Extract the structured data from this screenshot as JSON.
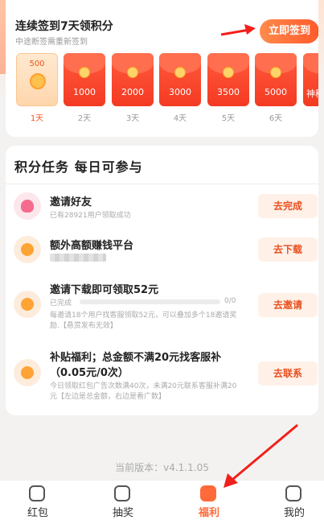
{
  "signin": {
    "title": "连续签到7天领积分",
    "subtitle": "中途断签需重新签到",
    "button": "立即签到",
    "envelopes": [
      {
        "amount": "500",
        "day": "1天",
        "state": "done"
      },
      {
        "amount": "1000",
        "day": "2天",
        "state": "pending"
      },
      {
        "amount": "2000",
        "day": "3天",
        "state": "pending"
      },
      {
        "amount": "3000",
        "day": "4天",
        "state": "pending"
      },
      {
        "amount": "3500",
        "day": "5天",
        "state": "pending"
      },
      {
        "amount": "5000",
        "day": "6天",
        "state": "pending"
      },
      {
        "amount": "神秘",
        "day": "",
        "state": "pending"
      }
    ]
  },
  "tasks": {
    "title": "积分任务  每日可参与",
    "items": [
      {
        "name": "邀请好友",
        "desc": "已有28921用户领取成功",
        "button": "去完成",
        "icon": "user-icon"
      },
      {
        "name": "额外高额赚钱平台",
        "desc": "",
        "button": "去下载",
        "icon": "coin-icon"
      },
      {
        "name": "邀请下载即可领取52元",
        "status": "已完成",
        "progress": "0/0",
        "progress_fraction": 0,
        "desc1": "每邀请18个用户找客服领取52元，可以叠加多个18邀请奖",
        "desc2": "励.【悬赏发布无效】",
        "button": "去邀请",
        "icon": "coin-icon"
      },
      {
        "name": "补贴福利；总金额不满20元找客服补",
        "name2": "（0.05元/0次）",
        "desc1": "今日领取红包广告次数满40次，未满20元联系客服补满20",
        "desc2": "元【左边是总金额，右边是看广数】",
        "button": "去联系",
        "icon": "coin-icon"
      }
    ]
  },
  "version": "当前版本：v4.1.1.05",
  "tabs": [
    {
      "label": "红包",
      "icon": "camera-icon",
      "active": false
    },
    {
      "label": "抽奖",
      "icon": "play-icon",
      "active": false
    },
    {
      "label": "福利",
      "icon": "tv-icon",
      "active": true
    },
    {
      "label": "我的",
      "icon": "profile-icon",
      "active": false
    }
  ],
  "colors": {
    "accent": "#ff6a3a",
    "arrow": "#f2201a"
  }
}
